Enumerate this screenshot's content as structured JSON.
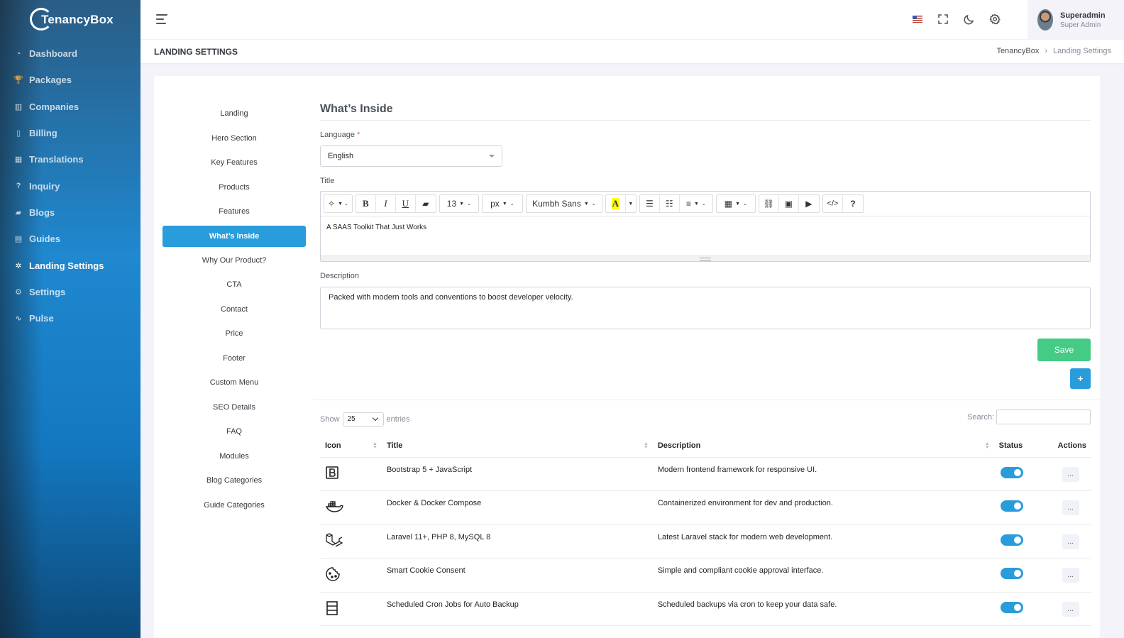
{
  "app": {
    "logo_text": "TenancyBox"
  },
  "sidebar": {
    "items": [
      {
        "label": "Dashboard",
        "icon": "dashboard-icon",
        "glyph": "◔"
      },
      {
        "label": "Packages",
        "icon": "trophy-icon",
        "glyph": "🏆"
      },
      {
        "label": "Companies",
        "icon": "building-icon",
        "glyph": "▥"
      },
      {
        "label": "Billing",
        "icon": "file-icon",
        "glyph": "▯"
      },
      {
        "label": "Translations",
        "icon": "translate-icon",
        "glyph": "▦"
      },
      {
        "label": "Inquiry",
        "icon": "question-icon",
        "glyph": "?"
      },
      {
        "label": "Blogs",
        "icon": "briefcase-icon",
        "glyph": "▰"
      },
      {
        "label": "Guides",
        "icon": "guide-icon",
        "glyph": "▤"
      },
      {
        "label": "Landing Settings",
        "icon": "settings-icon",
        "glyph": "✲"
      },
      {
        "label": "Settings",
        "icon": "gear-icon",
        "glyph": "⚙"
      },
      {
        "label": "Pulse",
        "icon": "pulse-icon",
        "glyph": "∿"
      }
    ],
    "active_index": 8
  },
  "topbar": {
    "user_name": "Superadmin",
    "user_role": "Super Admin"
  },
  "page": {
    "title": "LANDING SETTINGS",
    "breadcrumb_root": "TenancyBox",
    "breadcrumb_current": "Landing Settings"
  },
  "subnav": {
    "items": [
      "Landing",
      "Hero Section",
      "Key Features",
      "Products",
      "Features",
      "What’s Inside",
      "Why Our Product?",
      "CTA",
      "Contact",
      "Price",
      "Footer",
      "Custom Menu",
      "SEO Details",
      "FAQ",
      "Modules",
      "Blog Categories",
      "Guide Categories"
    ],
    "active_index": 5
  },
  "form": {
    "heading": "What’s Inside",
    "language_label": "Language",
    "language_required": "*",
    "language_value": "English",
    "title_label": "Title",
    "title_value": "A SAAS Toolkit That Just Works",
    "toolbar": {
      "font_size": "13",
      "unit": "px",
      "font_name": "Kumbh Sans"
    },
    "description_label": "Description",
    "description_value": "Packed with modern tools and conventions to boost developer velocity.",
    "save_label": "Save",
    "add_label": "+"
  },
  "table": {
    "show_label": "Show",
    "entries_value": "25",
    "entries_label": "entries",
    "search_label": "Search:",
    "columns": [
      "Icon",
      "Title",
      "Description",
      "Status",
      "Actions"
    ],
    "action_label": "...",
    "rows": [
      {
        "icon": "bootstrap-icon",
        "title": "Bootstrap 5 + JavaScript",
        "description": "Modern frontend framework for responsive UI.",
        "status": true
      },
      {
        "icon": "docker-icon",
        "title": "Docker & Docker Compose",
        "description": "Containerized environment for dev and production.",
        "status": true
      },
      {
        "icon": "laravel-icon",
        "title": "Laravel 11+, PHP 8, MySQL 8",
        "description": "Latest Laravel stack for modern web development.",
        "status": true
      },
      {
        "icon": "cookie-icon",
        "title": "Smart Cookie Consent",
        "description": "Simple and compliant cookie approval interface.",
        "status": true
      },
      {
        "icon": "server-icon",
        "title": "Scheduled Cron Jobs for Auto Backup",
        "description": "Scheduled backups via cron to keep your data safe.",
        "status": true
      }
    ]
  },
  "colors": {
    "primary": "#299cdb",
    "success": "#45cb85",
    "sidebar": "#1f88cf"
  }
}
